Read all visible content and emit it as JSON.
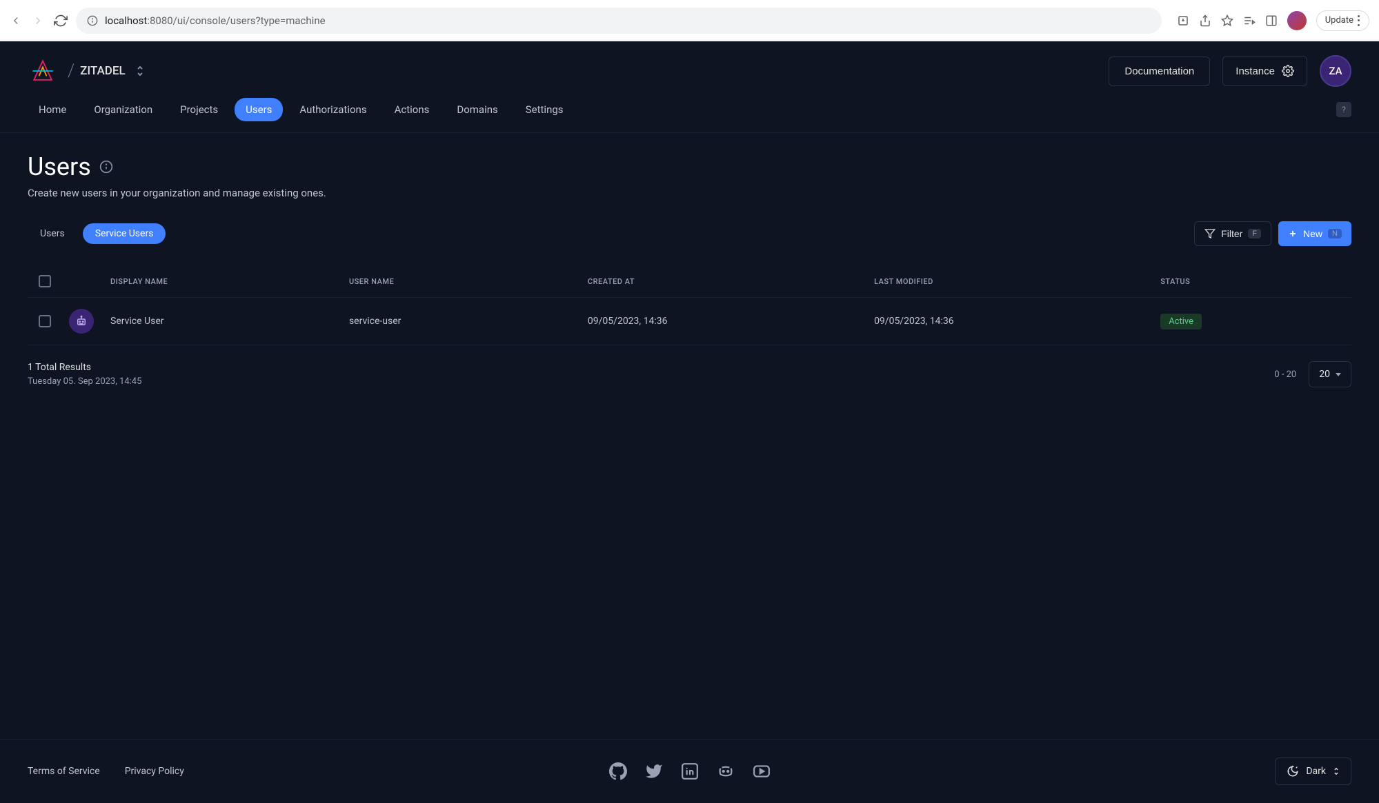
{
  "browser": {
    "url_host": "localhost",
    "url_path": ":8080/ui/console/users?type=machine",
    "update_label": "Update"
  },
  "header": {
    "org_name": "ZITADEL",
    "documentation_label": "Documentation",
    "instance_label": "Instance",
    "avatar_initials": "ZA"
  },
  "nav": {
    "items": [
      "Home",
      "Organization",
      "Projects",
      "Users",
      "Authorizations",
      "Actions",
      "Domains",
      "Settings"
    ],
    "help": "?"
  },
  "page": {
    "title": "Users",
    "description": "Create new users in your organization and manage existing ones."
  },
  "subtabs": {
    "users": "Users",
    "service_users": "Service Users"
  },
  "toolbar": {
    "filter_label": "Filter",
    "filter_key": "F",
    "new_label": "New",
    "new_key": "N"
  },
  "table": {
    "columns": {
      "display_name": "DISPLAY NAME",
      "user_name": "USER NAME",
      "created_at": "CREATED AT",
      "last_modified": "LAST MODIFIED",
      "status": "STATUS"
    },
    "rows": [
      {
        "display_name": "Service User",
        "user_name": "service-user",
        "created_at": "09/05/2023, 14:36",
        "last_modified": "09/05/2023, 14:36",
        "status": "Active"
      }
    ]
  },
  "results": {
    "total_label": "1 Total Results",
    "timestamp": "Tuesday 05. Sep 2023, 14:45",
    "range": "0 - 20",
    "page_size": "20"
  },
  "footer": {
    "tos": "Terms of Service",
    "privacy": "Privacy Policy",
    "theme_label": "Dark"
  }
}
